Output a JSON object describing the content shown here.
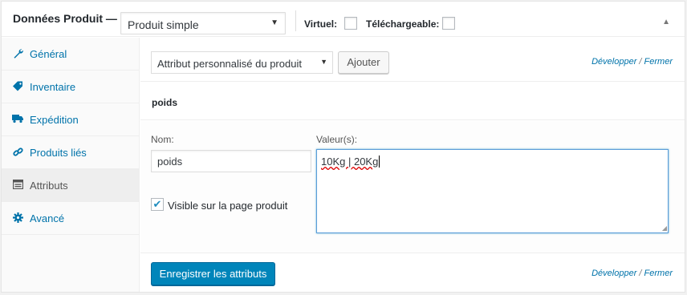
{
  "header": {
    "title": "Données Produit —",
    "product_type": "Produit simple",
    "virtual_label": "Virtuel:",
    "downloadable_label": "Téléchargeable:"
  },
  "sidebar": {
    "items": [
      {
        "label": "Général",
        "icon": "wrench-icon",
        "active": false
      },
      {
        "label": "Inventaire",
        "icon": "tag-icon",
        "active": false
      },
      {
        "label": "Expédition",
        "icon": "truck-icon",
        "active": false
      },
      {
        "label": "Produits liés",
        "icon": "link-icon",
        "active": false
      },
      {
        "label": "Attributs",
        "icon": "list-icon",
        "active": true
      },
      {
        "label": "Avancé",
        "icon": "gear-icon",
        "active": false
      }
    ]
  },
  "toolbar": {
    "attribute_select": "Attribut personnalisé du produit",
    "add_button": "Ajouter",
    "expand": "Développer",
    "separator": "/",
    "collapse": "Fermer"
  },
  "attribute": {
    "heading": "poids",
    "name_label": "Nom:",
    "name_value": "poids",
    "values_label": "Valeur(s):",
    "values_value": "10Kg | 20Kg",
    "visible_label": "Visible sur la page produit",
    "visible_checked": true
  },
  "footer": {
    "save_button": "Enregistrer les attributs",
    "expand": "Développer",
    "separator": "/",
    "collapse": "Fermer"
  },
  "colors": {
    "link": "#0073aa",
    "primary_button": "#0085ba",
    "focus_border": "#5b9dd9"
  }
}
